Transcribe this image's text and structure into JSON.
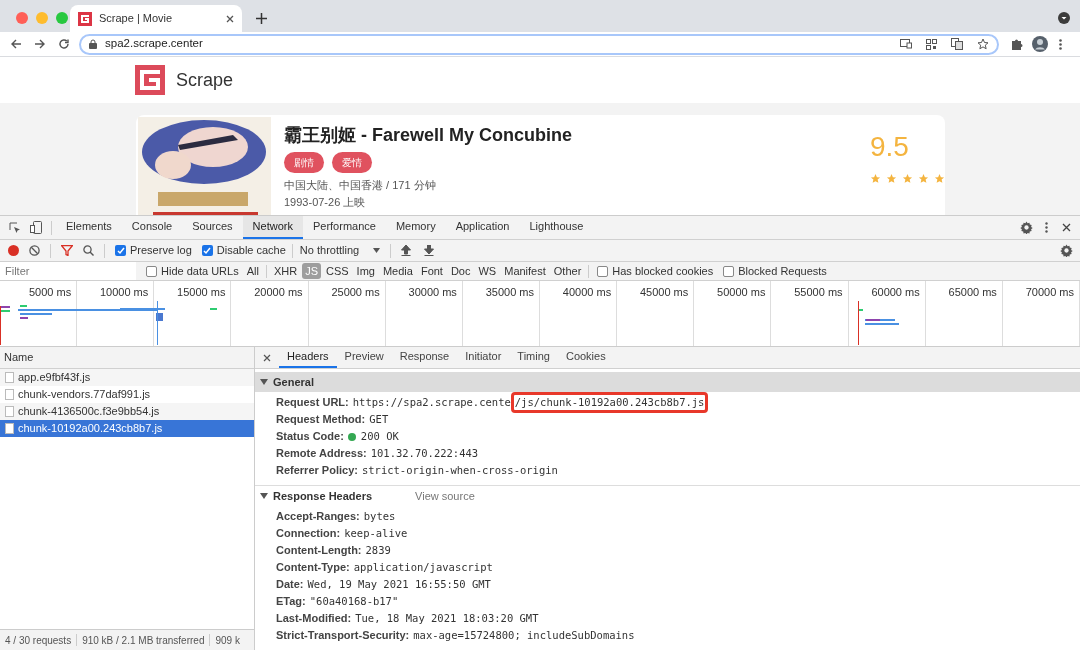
{
  "browser": {
    "tab_title": "Scrape | Movie",
    "url": "spa2.scrape.center"
  },
  "site": {
    "logo_text": "Scrape"
  },
  "movie": {
    "title": "霸王别姬 - Farewell My Concubine",
    "categories": [
      "剧情",
      "爱情"
    ],
    "info": "中国大陆、中国香港 / 171 分钟",
    "release": "1993-07-26 上映",
    "score": "9.5",
    "stars": 5
  },
  "devtools": {
    "tabs": [
      {
        "label": "Elements",
        "selected": false
      },
      {
        "label": "Console",
        "selected": false
      },
      {
        "label": "Sources",
        "selected": false
      },
      {
        "label": "Network",
        "selected": true
      },
      {
        "label": "Performance",
        "selected": false
      },
      {
        "label": "Memory",
        "selected": false
      },
      {
        "label": "Application",
        "selected": false
      },
      {
        "label": "Lighthouse",
        "selected": false
      }
    ],
    "toolbar": {
      "preserve_log": {
        "label": "Preserve log",
        "checked": true
      },
      "disable_cache": {
        "label": "Disable cache",
        "checked": true
      },
      "throttling": "No throttling"
    },
    "filter": {
      "placeholder": "Filter",
      "hide_data_urls": {
        "label": "Hide data URLs",
        "checked": false
      },
      "types": [
        {
          "label": "All",
          "selected": false
        },
        {
          "label": "XHR",
          "selected": false
        },
        {
          "label": "JS",
          "selected": true
        },
        {
          "label": "CSS",
          "selected": false
        },
        {
          "label": "Img",
          "selected": false
        },
        {
          "label": "Media",
          "selected": false
        },
        {
          "label": "Font",
          "selected": false
        },
        {
          "label": "Doc",
          "selected": false
        },
        {
          "label": "WS",
          "selected": false
        },
        {
          "label": "Manifest",
          "selected": false
        },
        {
          "label": "Other",
          "selected": false
        }
      ],
      "has_blocked_cookies": {
        "label": "Has blocked cookies",
        "checked": false
      },
      "blocked_requests": {
        "label": "Blocked Requests",
        "checked": false
      }
    },
    "timeline": {
      "ticks": [
        "5000 ms",
        "10000 ms",
        "15000 ms",
        "20000 ms",
        "25000 ms",
        "30000 ms",
        "35000 ms",
        "40000 ms",
        "45000 ms",
        "50000 ms",
        "55000 ms",
        "60000 ms",
        "65000 ms",
        "70000 ms"
      ]
    },
    "requests": {
      "column": "Name",
      "rows": [
        {
          "name": "app.e9fbf43f.js",
          "selected": false
        },
        {
          "name": "chunk-vendors.77daf991.js",
          "selected": false
        },
        {
          "name": "chunk-4136500c.f3e9bb54.js",
          "selected": false
        },
        {
          "name": "chunk-10192a00.243cb8b7.js",
          "selected": true
        }
      ]
    },
    "status_bar": [
      "4 / 30 requests",
      "910 kB / 2.1 MB transferred",
      "909 k"
    ],
    "detail_tabs": [
      {
        "label": "Headers",
        "selected": true
      },
      {
        "label": "Preview",
        "selected": false
      },
      {
        "label": "Response",
        "selected": false
      },
      {
        "label": "Initiator",
        "selected": false
      },
      {
        "label": "Timing",
        "selected": false
      },
      {
        "label": "Cookies",
        "selected": false
      }
    ],
    "general": {
      "title": "General",
      "expanded": true,
      "rows": [
        {
          "kind": "highlighted",
          "key": "Request URL:",
          "value": "https://spa2.scrape.cente",
          "highlight": "/js/chunk-10192a00.243cb8b7.js"
        },
        {
          "kind": "plain",
          "key": "Request Method:",
          "value": "GET"
        },
        {
          "kind": "status",
          "key": "Status Code:",
          "value": "200 OK"
        },
        {
          "kind": "plain",
          "key": "Remote Address:",
          "value": "101.32.70.222:443"
        },
        {
          "kind": "plain",
          "key": "Referrer Policy:",
          "value": "strict-origin-when-cross-origin"
        }
      ]
    },
    "response_headers": {
      "title": "Response Headers",
      "view_source": "View source",
      "expanded": true,
      "rows": [
        {
          "kind": "plain",
          "key": "Accept-Ranges:",
          "value": "bytes"
        },
        {
          "kind": "plain",
          "key": "Connection:",
          "value": "keep-alive"
        },
        {
          "kind": "plain",
          "key": "Content-Length:",
          "value": "2839"
        },
        {
          "kind": "plain",
          "key": "Content-Type:",
          "value": "application/javascript"
        },
        {
          "kind": "plain",
          "key": "Date:",
          "value": "Wed, 19 May 2021 16:55:50 GMT"
        },
        {
          "kind": "plain",
          "key": "ETag:",
          "value": "\"60a40168-b17\""
        },
        {
          "kind": "plain",
          "key": "Last-Modified:",
          "value": "Tue, 18 May 2021 18:03:20 GMT"
        },
        {
          "kind": "plain",
          "key": "Strict-Transport-Security:",
          "value": "max-age=15724800; includeSubDomains"
        }
      ]
    }
  }
}
